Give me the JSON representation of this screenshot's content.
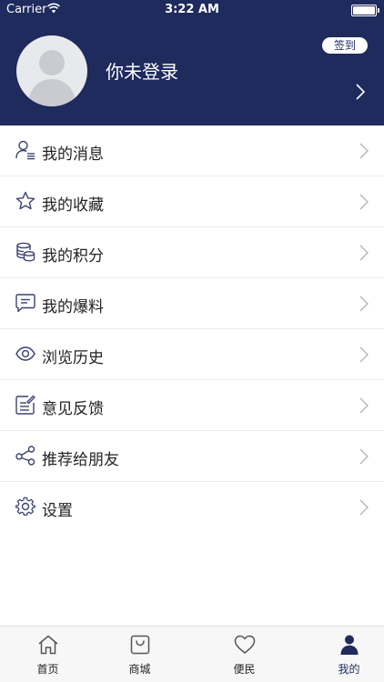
{
  "status_bar": {
    "carrier": "Carrier",
    "time": "3:22 AM"
  },
  "profile": {
    "login_text": "你未登录",
    "checkin_label": "签到"
  },
  "menu": {
    "items": [
      {
        "label": "我的消息",
        "icon": "user-message-icon"
      },
      {
        "label": "我的收藏",
        "icon": "star-icon"
      },
      {
        "label": "我的积分",
        "icon": "coins-icon"
      },
      {
        "label": "我的爆料",
        "icon": "chat-bubble-icon"
      },
      {
        "label": "浏览历史",
        "icon": "eye-icon"
      },
      {
        "label": "意见反馈",
        "icon": "feedback-edit-icon"
      },
      {
        "label": "推荐给朋友",
        "icon": "share-icon"
      },
      {
        "label": "设置",
        "icon": "gear-icon"
      }
    ]
  },
  "tabbar": {
    "tabs": [
      {
        "label": "首页",
        "icon": "home-icon"
      },
      {
        "label": "商城",
        "icon": "shopping-bag-icon"
      },
      {
        "label": "便民",
        "icon": "heart-icon"
      },
      {
        "label": "我的",
        "icon": "person-icon"
      }
    ],
    "active_index": 3
  },
  "colors": {
    "header_bg": "#1f2a5d",
    "accent": "#1f2a5d",
    "icon": "#3b4370"
  }
}
